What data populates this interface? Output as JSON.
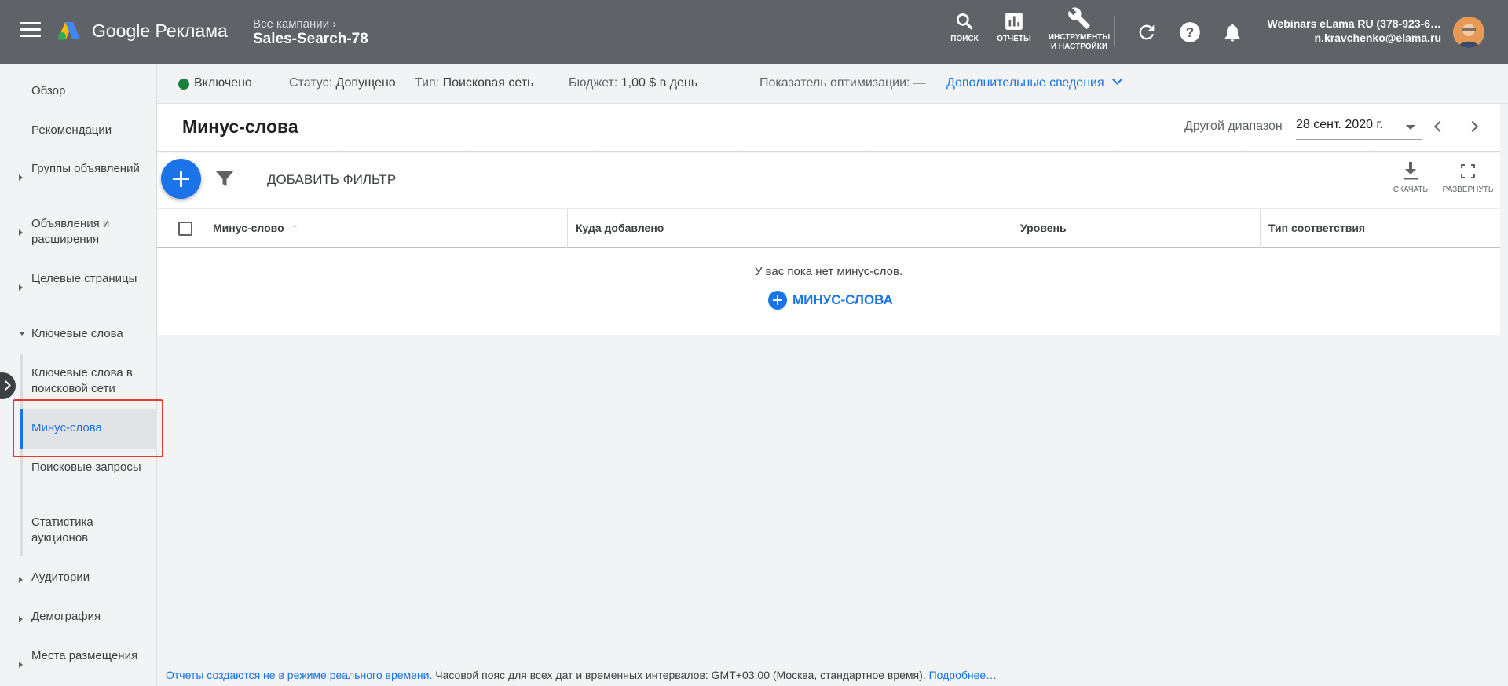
{
  "header": {
    "brand": "Google Реклама",
    "breadcrumb_parent": "Все кампании",
    "breadcrumb_current": "Sales-Search-78",
    "nav": {
      "search_label": "ПОИСК",
      "reports_label": "ОТЧЕТЫ",
      "tools_label_1": "ИНСТРУМЕНТЫ",
      "tools_label_2": "И НАСТРОЙКИ"
    },
    "account_name": "Webinars eLama RU (378-923-6…",
    "account_email": "n.kravchenko@elama.ru",
    "icons": [
      "menu-icon",
      "google-ads-logo",
      "search-icon",
      "reports-icon",
      "wrench-icon",
      "refresh-icon",
      "help-icon",
      "bell-icon",
      "avatar"
    ]
  },
  "sidebar": {
    "items": [
      {
        "label": "Обзор"
      },
      {
        "label": "Рекомендации"
      },
      {
        "label": "Группы объявлений"
      },
      {
        "label": "Объявления и расширения"
      },
      {
        "label": "Целевые страницы"
      },
      {
        "label": "Ключевые слова"
      },
      {
        "label": "Ключевые слова в поисковой сети"
      },
      {
        "label": "Минус-слова"
      },
      {
        "label": "Поисковые запросы"
      },
      {
        "label": "Статистика аукционов"
      },
      {
        "label": "Аудитории"
      },
      {
        "label": "Демография"
      },
      {
        "label": "Места размещения"
      }
    ],
    "active_item": "Минус-слова"
  },
  "status_bar": {
    "state": "Включено",
    "status_label": "Статус:",
    "status_value": "Допущено",
    "type_label": "Тип:",
    "type_value": "Поисковая сеть",
    "budget_label": "Бюджет:",
    "budget_value": "1,00 $ в день",
    "optimization_label": "Показатель оптимизации:",
    "optimization_value": "—",
    "more_details": "Дополнительные сведения"
  },
  "main": {
    "title": "Минус-слова",
    "range_label": "Другой диапазон",
    "range_value": "28 сент. 2020 г.",
    "add_filter": "ДОБАВИТЬ ФИЛЬТР",
    "download_label": "СКАЧАТЬ",
    "expand_label": "РАЗВЕРНУТЬ",
    "columns": [
      "Минус-слово",
      "Куда добавлено",
      "Уровень",
      "Тип соответствия"
    ],
    "empty_message": "У вас пока нет минус-слов.",
    "empty_action": "МИНУС-СЛОВА"
  },
  "footer": {
    "text_link": "Отчеты создаются не в режиме реального времени.",
    "text": " Часовой пояс для всех дат и временных интервалов: GMT+03:00 (Москва, стандартное время). ",
    "more_link": "Подробнее…"
  },
  "colors": {
    "topbar": "#5f6368",
    "accent": "#1a73e8",
    "enabled_dot": "#188038",
    "highlight": "#e53935"
  }
}
